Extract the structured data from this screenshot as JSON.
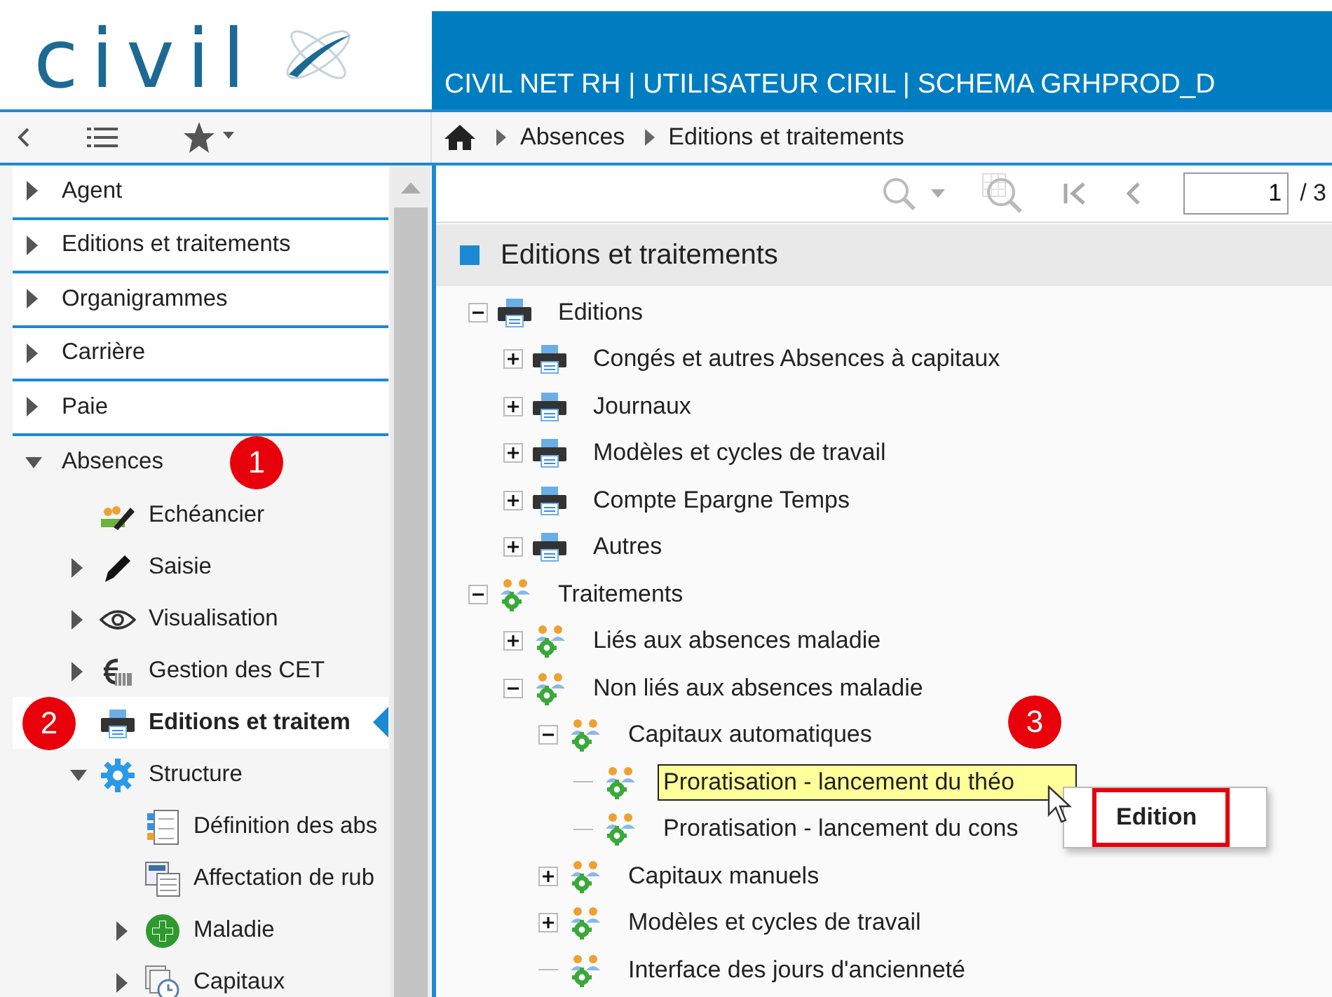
{
  "header": {
    "logo": "civil",
    "title": "CIVIL NET RH | UTILISATEUR CIRIL | SCHEMA GRHPROD_D"
  },
  "breadcrumb": [
    "Absences",
    "Editions et traitements"
  ],
  "sidebar": {
    "items": [
      {
        "label": "Agent",
        "expanded": false,
        "selected": false
      },
      {
        "label": "Editions et traitements",
        "expanded": false,
        "selected": false
      },
      {
        "label": "Organigrammes",
        "expanded": false,
        "selected": false
      },
      {
        "label": "Carrière",
        "expanded": false,
        "selected": false
      },
      {
        "label": "Paie",
        "expanded": false,
        "selected": false
      },
      {
        "label": "Absences",
        "expanded": true,
        "selected": false,
        "badge": "1",
        "children": [
          {
            "label": "Echéancier",
            "kind": "calendar",
            "selected": false
          },
          {
            "label": "Saisie",
            "kind": "pen",
            "expanded": false,
            "selected": false
          },
          {
            "label": "Visualisation",
            "kind": "eye",
            "expanded": false,
            "selected": false
          },
          {
            "label": "Gestion des CET",
            "kind": "money",
            "expanded": false,
            "selected": false
          },
          {
            "label": "Editions et traitem",
            "kind": "printer",
            "selected": true,
            "badge": "2"
          },
          {
            "label": "Structure",
            "kind": "gear",
            "expanded": true,
            "selected": false,
            "children": [
              {
                "label": "Définition des abs",
                "kind": "list",
                "selected": false
              },
              {
                "label": "Affectation de rub",
                "kind": "form",
                "selected": false
              },
              {
                "label": "Maladie",
                "kind": "cross",
                "expanded": false,
                "selected": false
              },
              {
                "label": "Capitaux",
                "kind": "clock",
                "expanded": false,
                "selected": false
              }
            ]
          }
        ]
      }
    ]
  },
  "toolbar": {
    "page": "1",
    "total": "/ 3"
  },
  "panel": {
    "title": "Editions et traitements",
    "tree": [
      {
        "label": "Editions",
        "kind": "print",
        "expanded": true,
        "selected": false,
        "children": [
          {
            "label": "Congés et autres Absences à capitaux",
            "kind": "print",
            "expanded": false,
            "selected": false
          },
          {
            "label": "Journaux",
            "kind": "print",
            "expanded": false,
            "selected": false
          },
          {
            "label": "Modèles et cycles de travail",
            "kind": "print",
            "expanded": false,
            "selected": false
          },
          {
            "label": "Compte Epargne Temps",
            "kind": "print",
            "expanded": false,
            "selected": false
          },
          {
            "label": "Autres",
            "kind": "print",
            "expanded": false,
            "selected": false
          }
        ]
      },
      {
        "label": "Traitements",
        "kind": "process",
        "expanded": true,
        "selected": false,
        "children": [
          {
            "label": "Liés aux absences maladie",
            "kind": "process",
            "expanded": false,
            "selected": false
          },
          {
            "label": "Non liés aux absences maladie",
            "kind": "process",
            "expanded": true,
            "selected": false,
            "children": [
              {
                "label": "Capitaux automatiques",
                "kind": "process",
                "expanded": true,
                "selected": false,
                "badge": "3",
                "children": [
                  {
                    "label": "Proratisation - lancement du théo",
                    "kind": "process",
                    "selected": true
                  },
                  {
                    "label": "Proratisation - lancement du cons",
                    "kind": "process",
                    "selected": false
                  }
                ]
              },
              {
                "label": "Capitaux manuels",
                "kind": "process",
                "expanded": false,
                "selected": false
              },
              {
                "label": "Modèles et cycles de travail",
                "kind": "process",
                "expanded": false,
                "selected": false
              },
              {
                "label": "Interface des jours d'ancienneté",
                "kind": "process",
                "selected": false
              }
            ]
          }
        ]
      }
    ]
  },
  "context_menu": {
    "items": [
      {
        "label": "Edition",
        "highlighted": true
      }
    ]
  }
}
